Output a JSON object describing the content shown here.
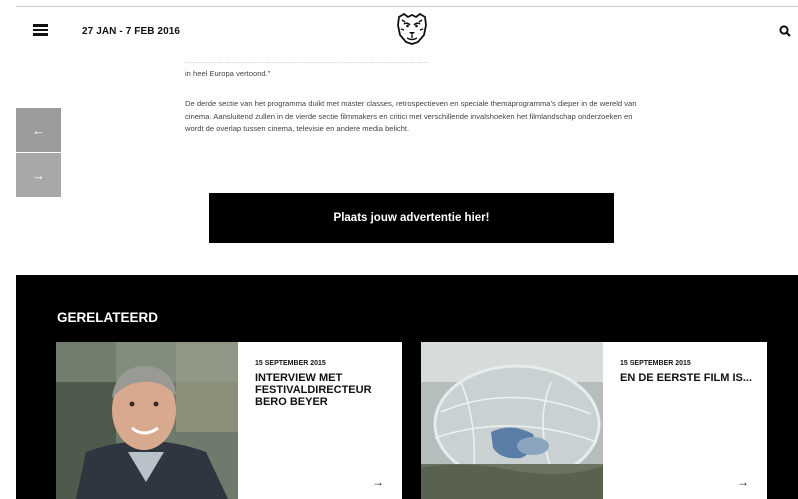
{
  "header": {
    "dates": "27 JAN - 7 FEB 2016"
  },
  "nav": {
    "prev_arrow": "←",
    "next_arrow": "→"
  },
  "article": {
    "cut_line": "...................................................................................................................",
    "line1": "in heel Europa vertoond.”",
    "paragraph2": "De derde sectie van het programma duikt met master classes, retrospectieven en speciale themaprogramma’s dieper in de wereld van cinema. Aansluitend zullen in de vierde sectie filmmakers en critici met verschillende invalshoeken het filmlandschap onderzoeken en wordt de overlap tussen cinema, televisie en andere media belicht."
  },
  "ad": {
    "label": "Plaats jouw advertentie hier!"
  },
  "related": {
    "title": "GERELATEERD",
    "cards": [
      {
        "date": "15 SEPTEMBER 2015",
        "headline": "INTERVIEW MET FESTIVALDIRECTEUR BERO BEYER",
        "arrow": "→"
      },
      {
        "date": "15 SEPTEMBER 2015",
        "headline": "EN DE EERSTE FILM IS...",
        "arrow": "→"
      }
    ]
  },
  "colors": {
    "background": "#ffffff",
    "dark_section": "#000000",
    "arrow_button": "#9b9b9b"
  },
  "icons": {
    "menu": "hamburger-icon",
    "logo": "tiger-head-logo",
    "search": "search-icon"
  }
}
